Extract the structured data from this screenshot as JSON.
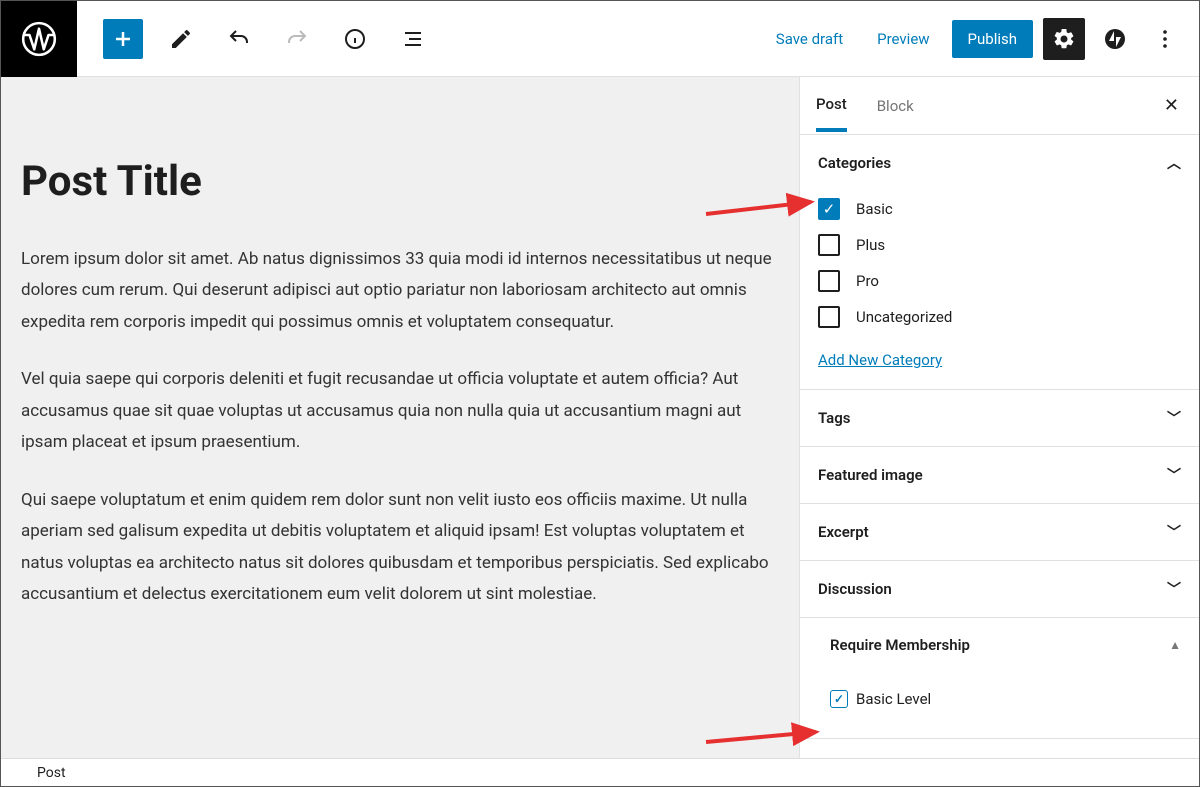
{
  "toolbar": {
    "save_draft": "Save draft",
    "preview": "Preview",
    "publish": "Publish"
  },
  "canvas": {
    "title": "Post Title",
    "p1": "Lorem ipsum dolor sit amet. Ab natus dignissimos 33 quia modi id internos necessitatibus ut neque dolores cum rerum. Qui deserunt adipisci aut optio pariatur non laboriosam architecto aut omnis expedita rem corporis impedit qui possimus omnis et voluptatem consequatur.",
    "p2": "Vel quia saepe qui corporis deleniti et fugit recusandae ut officia voluptate et autem officia? Aut accusamus quae sit quae voluptas ut accusamus quia non nulla quia ut accusantium magni aut ipsam placeat et ipsum praesentium.",
    "p3": "Qui saepe voluptatum et enim quidem rem dolor sunt non velit iusto eos officiis maxime. Ut nulla aperiam sed galisum expedita ut debitis voluptatem et aliquid ipsam! Est voluptas voluptatem et natus voluptas ea architecto natus sit dolores quibusdam et temporibus perspiciatis. Sed explicabo accusantium et delectus exercitationem eum velit dolorem ut sint molestiae."
  },
  "sidebar": {
    "tabs": {
      "post": "Post",
      "block": "Block"
    },
    "categories": {
      "header": "Categories",
      "items": [
        "Basic",
        "Plus",
        "Pro",
        "Uncategorized"
      ],
      "add": "Add New Category"
    },
    "panels": {
      "tags": "Tags",
      "featured": "Featured image",
      "excerpt": "Excerpt",
      "discussion": "Discussion",
      "require_membership": "Require Membership"
    },
    "membership": {
      "basic": "Basic Level"
    }
  },
  "footer": {
    "path": "Post"
  }
}
